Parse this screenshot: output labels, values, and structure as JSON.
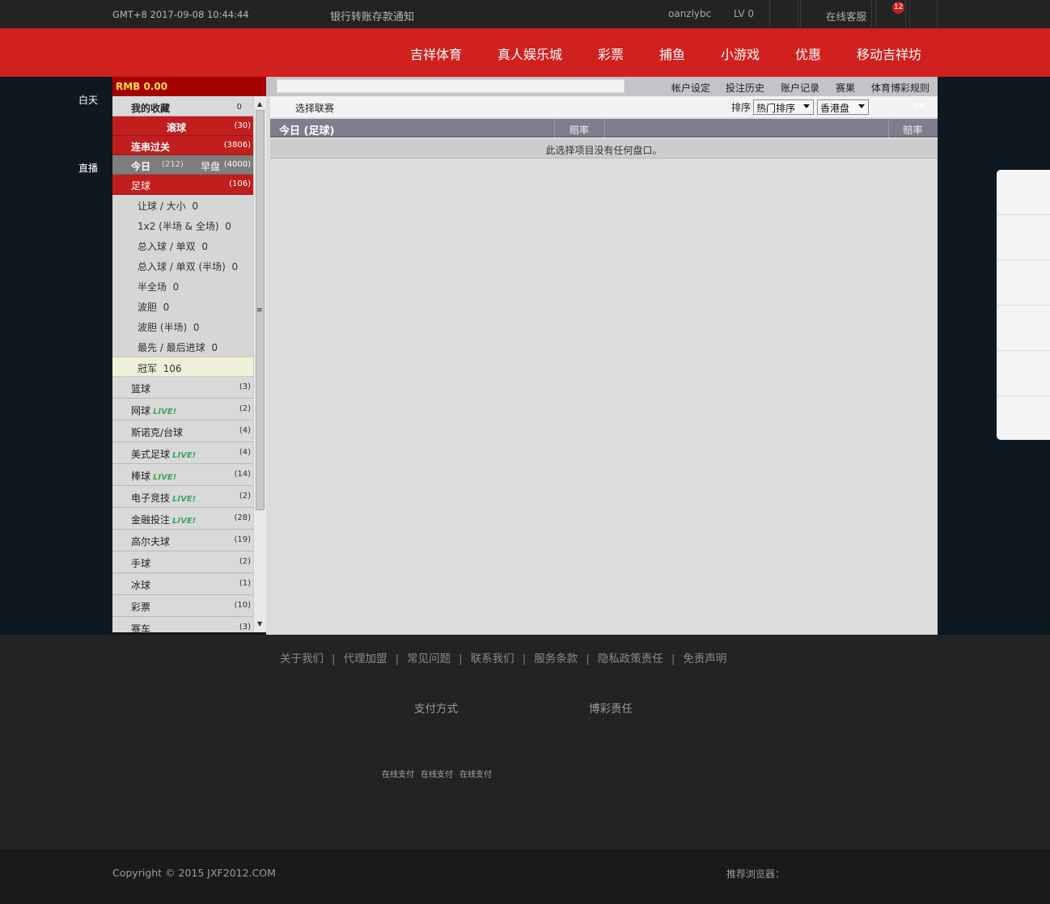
{
  "topbar": {
    "datetime": "GMT+8 2017-09-08 10:44:44",
    "notice": "银行转账存款通知",
    "username": "oanzlybc",
    "level": "LV 0",
    "service": "在线客服",
    "badge": "12"
  },
  "nav": [
    "吉祥体育",
    "真人娱乐城",
    "彩票",
    "捕鱼",
    "小游戏",
    "优惠",
    "移动吉祥坊"
  ],
  "side": {
    "day": "白天",
    "live": "直播"
  },
  "balance": "RMB 0.00",
  "left": {
    "favorites": {
      "label": "我的收藏",
      "count": "0"
    },
    "rolling": {
      "label": "滚球",
      "count": "(30)"
    },
    "parlay": {
      "label": "连串过关",
      "count": "(3806)"
    },
    "today": {
      "label": "今日",
      "count": "(212)"
    },
    "early": {
      "label": "早盘",
      "count": "(4000)"
    },
    "football": {
      "label": "足球",
      "count": "(106)"
    },
    "football_sub": [
      {
        "label": "让球 / 大小",
        "count": "0"
      },
      {
        "label": "1x2 (半场 & 全场)",
        "count": "0"
      },
      {
        "label": "总入球 / 单双",
        "count": "0"
      },
      {
        "label": "总入球 / 单双 (半场)",
        "count": "0"
      },
      {
        "label": "半全场",
        "count": "0"
      },
      {
        "label": "波胆",
        "count": "0"
      },
      {
        "label": "波胆 (半场)",
        "count": "0"
      },
      {
        "label": "最先 / 最后进球",
        "count": "0"
      },
      {
        "label": "冠军",
        "count": "106"
      }
    ],
    "live_tag": "LIVE!",
    "sports": [
      {
        "label": "篮球",
        "count": "(3)"
      },
      {
        "label": "网球",
        "count": "(2)",
        "live": "LIVE!"
      },
      {
        "label": "斯诺克/台球",
        "count": "(4)"
      },
      {
        "label": "美式足球",
        "count": "(4)",
        "live": "LIVE!"
      },
      {
        "label": "棒球",
        "count": "(14)",
        "live": "LIVE!"
      },
      {
        "label": "电子竞技",
        "count": "(2)",
        "live": "LIVE!"
      },
      {
        "label": "金融投注",
        "count": "(28)",
        "live": "LIVE!"
      },
      {
        "label": "高尔夫球",
        "count": "(19)"
      },
      {
        "label": "手球",
        "count": "(2)"
      },
      {
        "label": "冰球",
        "count": "(1)"
      },
      {
        "label": "彩票",
        "count": "(10)"
      },
      {
        "label": "赛车",
        "count": "(3)"
      }
    ]
  },
  "main": {
    "links": [
      "帐户设定",
      "投注历史",
      "账户记录",
      "赛果",
      "体育博彩规则"
    ],
    "select_league": "选择联赛",
    "sort_label": "排序",
    "sort_value": "热门排序",
    "odds_value": "香港盘",
    "refresh_count": "58",
    "table_title": "今日 (足球)",
    "col_odds_1": "赔率",
    "col_odds_2": "赔率",
    "empty_message": "此选择项目没有任何盘口。"
  },
  "footer": {
    "links": [
      "关于我们",
      "代理加盟",
      "常见问题",
      "联系我们",
      "服务条款",
      "隐私政策责任",
      "免责声明"
    ],
    "payment_title": "支付方式",
    "responsibility_title": "博彩责任",
    "payments": [
      "在线支付",
      "在线支付",
      "在线支付"
    ],
    "copyright": "Copyright © 2015 JXF2012.COM",
    "browser": "推荐浏览器："
  },
  "colors": {
    "brand_red": "#d1211f",
    "dark_red": "#a50000",
    "live_green": "#3aa85a"
  }
}
